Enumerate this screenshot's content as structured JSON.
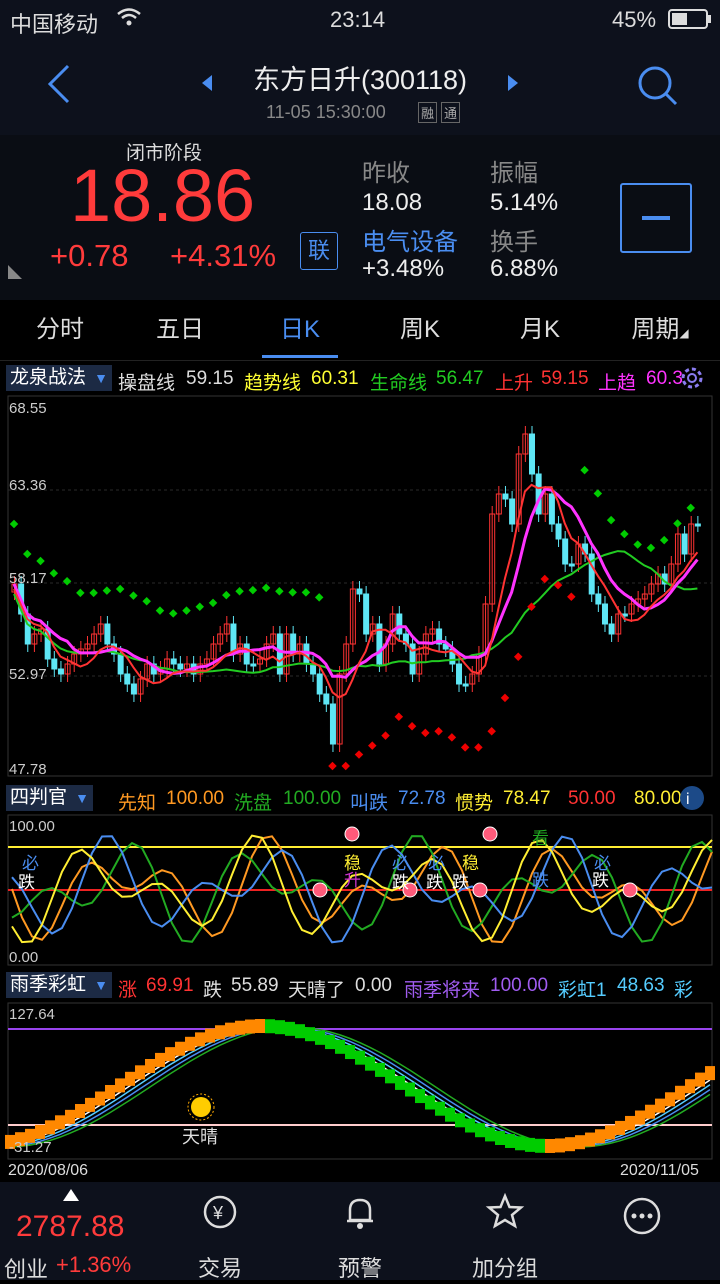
{
  "status": {
    "carrier": "中国移动",
    "time": "23:14",
    "battery": "45%"
  },
  "header": {
    "title": "东方日升(300118)",
    "datetime": "11-05 15:30:00",
    "badges": [
      "融",
      "通"
    ]
  },
  "quote": {
    "phase": "闭市阶段",
    "price": "18.86",
    "change": "+0.78",
    "change_pct": "+4.31%",
    "link_label": "联",
    "prev_close_label": "昨收",
    "prev_close": "18.08",
    "amplitude_label": "振幅",
    "amplitude": "5.14%",
    "sector": "电气设备",
    "sector_change": "+3.48%",
    "turnover_label": "换手",
    "turnover": "6.88%"
  },
  "tabs": [
    "分时",
    "五日",
    "日K",
    "周K",
    "月K",
    "周期"
  ],
  "active_tab": 2,
  "main_chart": {
    "indicator": "龙泉战法",
    "legend": [
      {
        "label": "操盘线",
        "value": "59.15"
      },
      {
        "label": "趋势线",
        "value": "60.31"
      },
      {
        "label": "生命线",
        "value": "56.47"
      },
      {
        "label": "上升",
        "value": "59.15"
      },
      {
        "label": "上趋",
        "value": "60.3"
      }
    ],
    "colors": {
      "up": "#ff3333",
      "down": "#5ee6f5",
      "life": "#22cc22",
      "trend": "#ffff33",
      "op": "#ff33ff",
      "green_dot": "#00cc00",
      "red_dot": "#ee0000"
    },
    "y_labels": [
      "68.55",
      "63.36",
      "58.17",
      "52.97",
      "47.78"
    ]
  },
  "panel2": {
    "indicator": "四判官",
    "legend": [
      {
        "label": "先知",
        "value": "100.00"
      },
      {
        "label": "洗盘",
        "value": "100.00"
      },
      {
        "label": "叫跌",
        "value": "72.78"
      },
      {
        "label": "惯势",
        "value": "78.47"
      },
      {
        "label": "",
        "value": "50.00"
      },
      {
        "label": "",
        "value": "80.00"
      }
    ],
    "y_labels": [
      "100.00",
      "0.00"
    ],
    "signals": [
      "必",
      "跌",
      "稳",
      "升",
      "必",
      "跌",
      "必",
      "跌",
      "稳",
      "跌",
      "看",
      "跌",
      "必",
      "跌"
    ]
  },
  "panel3": {
    "indicator": "雨季彩虹",
    "legend": [
      {
        "label": "涨",
        "value": "69.91"
      },
      {
        "label": "跌",
        "value": "55.89"
      },
      {
        "label": "天晴了",
        "value": "0.00"
      },
      {
        "label": "雨季将来",
        "value": "100.00"
      },
      {
        "label": "彩虹1",
        "value": "48.63"
      },
      {
        "label": "彩",
        "value": ""
      }
    ],
    "y_labels": [
      "127.64",
      "-31.27"
    ],
    "annotation": "天晴",
    "date_start": "2020/08/06",
    "date_end": "2020/11/05"
  },
  "bottom": {
    "index_value": "2787.88",
    "index_name": "创业",
    "index_change": "+1.36%",
    "nav": [
      "交易",
      "预警",
      "加分组"
    ]
  }
}
